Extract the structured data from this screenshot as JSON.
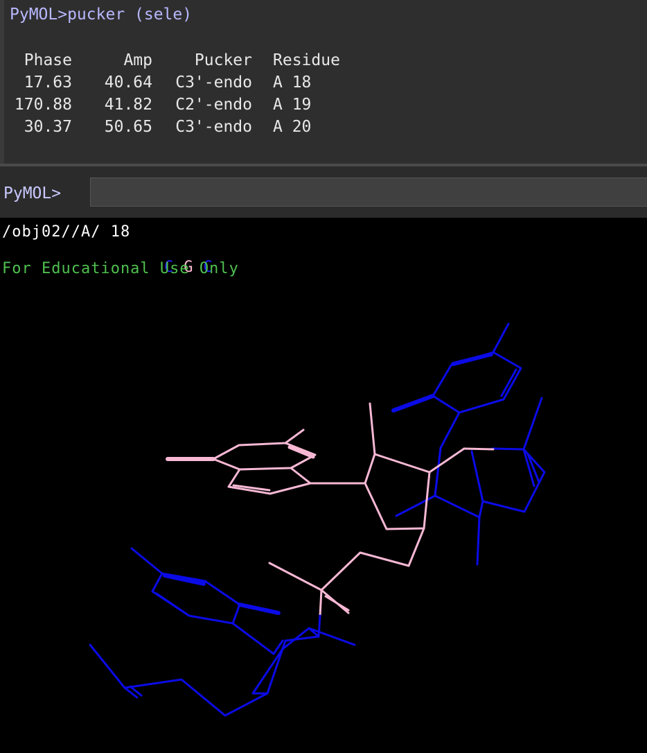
{
  "console": {
    "clipped_line": "    ···   ···  ···",
    "command_echo": "PyMOL>pucker (sele)",
    "table": {
      "headers": [
        "Phase",
        "Amp",
        "Pucker",
        "Residue"
      ],
      "rows": [
        [
          "17.63",
          "40.64",
          "C3'-endo",
          "A 18"
        ],
        [
          "170.88",
          "41.82",
          "C2'-endo",
          "A 19"
        ],
        [
          "30.37",
          "50.65",
          "C3'-endo",
          "A 20"
        ]
      ]
    }
  },
  "prompt": {
    "label": "PyMOL>",
    "value": ""
  },
  "viewer": {
    "selection_label": "/obj02//A/ 18",
    "sequence": [
      {
        "letter": "C",
        "color": "#2323ff"
      },
      {
        "letter": "G",
        "color": "#ffb6d2"
      },
      {
        "letter": "C",
        "color": "#2323ff"
      }
    ],
    "watermark": "For Educational Use Only",
    "colors": {
      "blue_residue": "#0b0be6",
      "pink_residue": "#f7b8d4",
      "watermark": "#4fc04f",
      "console_bg": "#2e2e2e",
      "prompt_text": "#b8b8ff"
    }
  }
}
